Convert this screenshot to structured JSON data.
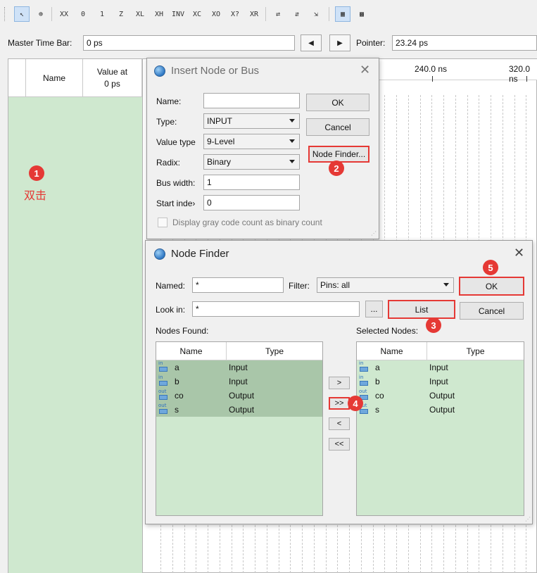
{
  "toolbar": {
    "tools": [
      {
        "icon": "selection-tool-icon",
        "glyph": "↖",
        "active": true
      },
      {
        "icon": "zoom-tool-icon",
        "glyph": "⊕",
        "active": false
      },
      {
        "icon": "unknown-value-icon",
        "glyph": "XX"
      },
      {
        "icon": "force-low-icon",
        "glyph": "0"
      },
      {
        "icon": "force-high-icon",
        "glyph": "1"
      },
      {
        "icon": "high-impedance-icon",
        "glyph": "Z"
      },
      {
        "icon": "weak-low-icon",
        "glyph": "XL"
      },
      {
        "icon": "weak-high-icon",
        "glyph": "XH"
      },
      {
        "icon": "invert-icon",
        "glyph": "INV"
      },
      {
        "icon": "count-value-icon",
        "glyph": "XC"
      },
      {
        "icon": "clock-icon",
        "glyph": "XO"
      },
      {
        "icon": "arbitrary-value-icon",
        "glyph": "X?"
      },
      {
        "icon": "random-value-icon",
        "glyph": "XR"
      },
      {
        "icon": "snap-to-grid-icon",
        "glyph": "⇄"
      },
      {
        "icon": "sort-icon",
        "glyph": "⇵"
      },
      {
        "icon": "arrange-icon",
        "glyph": "⇲"
      },
      {
        "icon": "waveform-view-icon",
        "glyph": "▦",
        "active": true
      },
      {
        "icon": "grid-view-icon",
        "glyph": "▩"
      }
    ]
  },
  "time_bar": {
    "master_label": "Master Time Bar:",
    "master_value": "0 ps",
    "prev_glyph": "◀",
    "next_glyph": "▶",
    "pointer_label": "Pointer:",
    "pointer_value": "23.24 ps"
  },
  "waveform": {
    "name_header": "Name",
    "value_header_line1": "Value at",
    "value_header_line2": "0 ps",
    "time_ticks": [
      "240.0 ns",
      "320.0 ns"
    ]
  },
  "annotations": {
    "step1": "1",
    "step1_text": "双击",
    "step2": "2",
    "step3": "3",
    "step4": "4",
    "step5": "5"
  },
  "insert_dialog": {
    "title": "Insert Node or Bus",
    "name_label": "Name:",
    "name_value": "",
    "type_label": "Type:",
    "type_value": "INPUT",
    "value_type_label": "Value type",
    "value_type_value": "9-Level",
    "radix_label": "Radix:",
    "radix_value": "Binary",
    "bus_width_label": "Bus width:",
    "bus_width_value": "1",
    "start_index_label": "Start inde›",
    "start_index_value": "0",
    "gray_code_label": "Display gray code count as binary count",
    "ok": "OK",
    "cancel": "Cancel",
    "node_finder": "Node Finder..."
  },
  "node_finder": {
    "title": "Node Finder",
    "named_label": "Named:",
    "named_value": "*",
    "filter_label": "Filter:",
    "filter_value": "Pins: all",
    "look_in_label": "Look in:",
    "look_in_value": "*",
    "browse": "...",
    "list": "List",
    "ok": "OK",
    "cancel": "Cancel",
    "nodes_found_label": "Nodes Found:",
    "selected_nodes_label": "Selected Nodes:",
    "col_name": "Name",
    "col_type": "Type",
    "found_nodes": [
      {
        "tag": "in",
        "name": "a",
        "type": "Input"
      },
      {
        "tag": "in",
        "name": "b",
        "type": "Input"
      },
      {
        "tag": "out",
        "name": "co",
        "type": "Output"
      },
      {
        "tag": "out",
        "name": "s",
        "type": "Output"
      }
    ],
    "selected_nodes": [
      {
        "tag": "in",
        "name": "a",
        "type": "Input"
      },
      {
        "tag": "in",
        "name": "b",
        "type": "Input"
      },
      {
        "tag": "out",
        "name": "co",
        "type": "Output"
      },
      {
        "tag": "out",
        "name": "s",
        "type": "Output"
      }
    ],
    "move_right": ">",
    "move_all_right": ">>",
    "move_left": "<",
    "move_all_left": "<<"
  },
  "colors": {
    "accent_red": "#e53935",
    "list_green": "#cfe8cf",
    "row_selected": "#a9c6a9"
  }
}
